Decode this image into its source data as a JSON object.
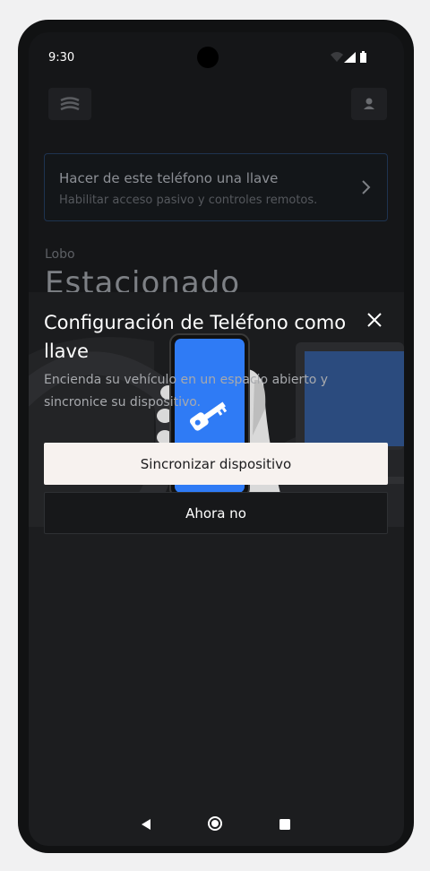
{
  "status_bar": {
    "time": "9:30",
    "icons": [
      "wifi-icon",
      "signal-icon",
      "battery-icon"
    ]
  },
  "background_app": {
    "logo_icon": "car-logo-icon",
    "profile_icon": "person-icon",
    "key_card": {
      "title": "Hacer de este teléfono una llave",
      "subtitle": "Habilitar acceso pasivo y controles remotos.",
      "chevron_icon": "chevron-right-icon"
    },
    "vehicle_name": "Lobo",
    "vehicle_status": "Estacionado"
  },
  "sheet": {
    "close_icon": "close-icon",
    "hero_icons": [
      "phone-key-icon"
    ],
    "title": "Configuración de Teléfono como llave",
    "description": "Encienda su vehículo en un espacio abierto y sincronice su dispositivo.",
    "primary_button": "Sincronizar dispositivo",
    "secondary_button": "Ahora no"
  },
  "nav_bar": {
    "icons": [
      "back-icon",
      "home-icon",
      "recents-icon"
    ]
  },
  "colors": {
    "primary_button_bg": "#f7f2ef",
    "phone_screen_blue": "#2f7bf5",
    "sheet_bg": "#1c1d1f"
  }
}
